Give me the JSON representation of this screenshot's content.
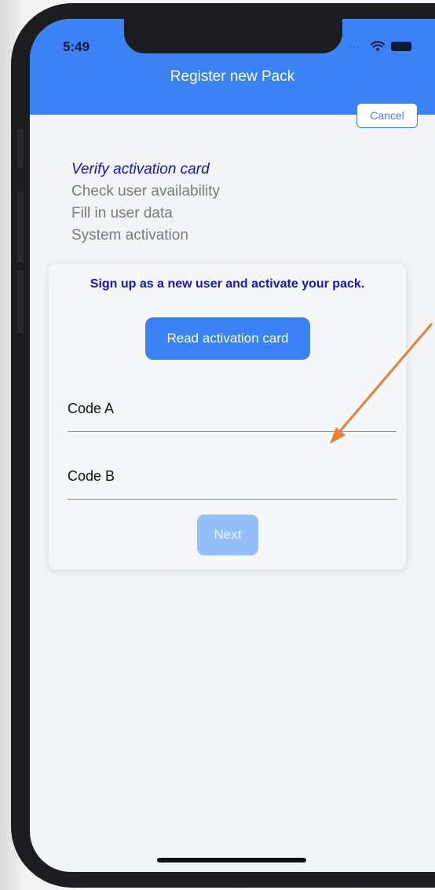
{
  "status_bar": {
    "time": "5:49"
  },
  "header": {
    "title": "Register new Pack",
    "cancel_label": "Cancel"
  },
  "steps": [
    {
      "label": "Verify activation card",
      "active": true
    },
    {
      "label": "Check user availability",
      "active": false
    },
    {
      "label": "Fill in user data",
      "active": false
    },
    {
      "label": "System activation",
      "active": false
    }
  ],
  "card": {
    "heading": "Sign up as a new user and activate your pack.",
    "read_button_label": "Read activation card",
    "fields": [
      {
        "label": "Code A",
        "value": ""
      },
      {
        "label": "Code B",
        "value": ""
      }
    ],
    "next_label": "Next"
  },
  "colors": {
    "header_bg": "#3b82f6",
    "accent": "#3b82f6",
    "active_step": "#1414c8",
    "inactive_step": "#7a7a7a",
    "disabled_button": "#93c0fb",
    "annotation_arrow": "#ed7d31"
  },
  "icons": [
    "cellular-dots-icon",
    "wifi-icon",
    "battery-icon",
    "annotation-arrow-icon"
  ]
}
